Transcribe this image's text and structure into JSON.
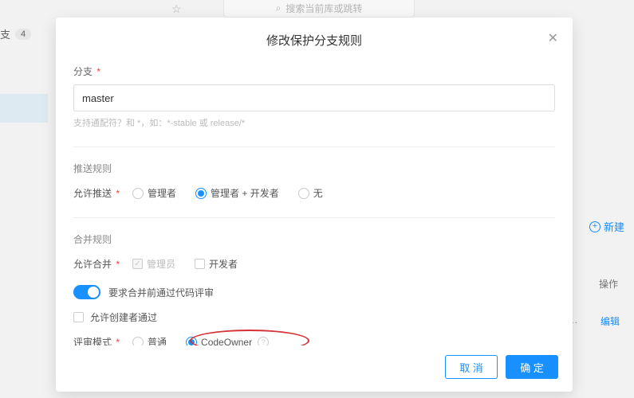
{
  "bg": {
    "search_placeholder": "搜索当前库或跳转",
    "tab_label": "支",
    "tab_count": "4",
    "new_label": "新建",
    "op_label": "操作",
    "edit_label": "编辑",
    "ellipsis": ".w..."
  },
  "modal": {
    "title": "修改保护分支规则",
    "branch": {
      "label": "分支",
      "value": "master",
      "hint": "支持通配符？和 *，如：*-stable 或 release/*"
    },
    "push_rules": {
      "title": "推送规则",
      "allow_push_label": "允许推送",
      "options": {
        "admin": "管理者",
        "admin_dev": "管理者 + 开发者",
        "none": "无"
      },
      "selected": "admin_dev"
    },
    "merge_rules": {
      "title": "合并规则",
      "allow_merge_label": "允许合并",
      "options": {
        "admin": "管理员",
        "dev": "开发者"
      },
      "admin_checked": true,
      "dev_checked": false
    },
    "review": {
      "require_review_label": "要求合并前通过代码评审",
      "allow_creator_label": "允许创建者通过",
      "mode_label": "评审模式",
      "options": {
        "normal": "普通",
        "codeowner": "CodeOwner"
      },
      "selected": "codeowner"
    },
    "footer": {
      "cancel": "取 消",
      "ok": "确 定"
    }
  }
}
